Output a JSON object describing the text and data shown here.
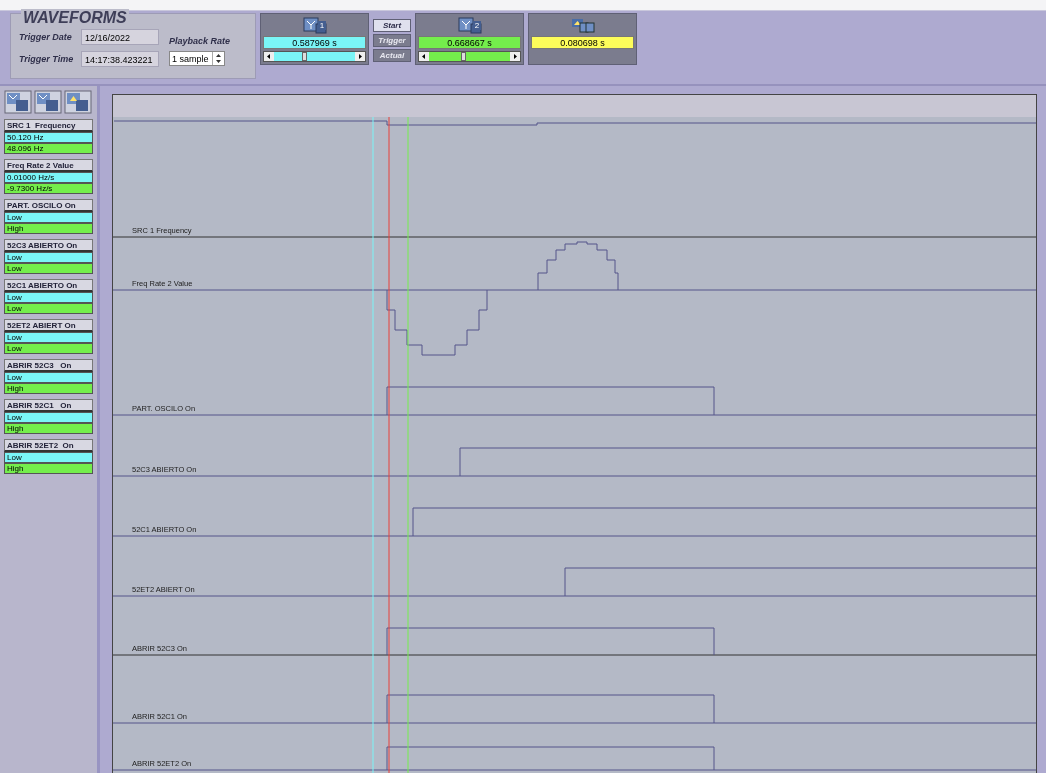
{
  "header": {
    "title": "WAVEFORMS",
    "trigger_date": {
      "label": "Trigger Date",
      "value": "12/16/2022"
    },
    "trigger_time": {
      "label": "Trigger Time",
      "value": "14:17:38.423221"
    },
    "playback_rate": {
      "label": "Playback Rate",
      "value": "1 sample"
    }
  },
  "cursors": [
    {
      "kind": "cursor1",
      "number": "1",
      "value": "0.587969 s",
      "color": "#7af5f7"
    },
    {
      "kind": "cursor2",
      "number": "2",
      "value": "0.668667 s",
      "color": "#74ee4c"
    },
    {
      "kind": "delta",
      "value": "0.080698 s",
      "color": "#fdfd5a"
    }
  ],
  "mode_buttons": [
    {
      "label": "Start",
      "selected": true
    },
    {
      "label": "Trigger",
      "selected": false
    },
    {
      "label": "Actual",
      "selected": false
    }
  ],
  "channels": [
    {
      "name": "SRC 1  Frequency",
      "cursor1": "50.120 Hz",
      "cursor2": "48.096 Hz"
    },
    {
      "name": "Freq Rate 2 Value",
      "cursor1": "0.01000 Hz/s",
      "cursor2": "-9.7300 Hz/s"
    },
    {
      "name": "PART. OSCILO On",
      "cursor1": "Low",
      "cursor2": "High"
    },
    {
      "name": "52C3 ABIERTO On",
      "cursor1": "Low",
      "cursor2": "Low"
    },
    {
      "name": "52C1 ABIERTO On",
      "cursor1": "Low",
      "cursor2": "Low"
    },
    {
      "name": "52ET2 ABIERT On",
      "cursor1": "Low",
      "cursor2": "Low"
    },
    {
      "name": "ABRIR 52C3   On",
      "cursor1": "Low",
      "cursor2": "High"
    },
    {
      "name": "ABRIR 52C1   On",
      "cursor1": "Low",
      "cursor2": "High"
    },
    {
      "name": "ABRIR 52ET2  On",
      "cursor1": "Low",
      "cursor2": "High"
    }
  ],
  "traces": [
    {
      "label": "SRC 1  Frequency"
    },
    {
      "label": "Freq Rate 2 Value"
    },
    {
      "label": "PART. OSCILO On"
    },
    {
      "label": "52C3 ABIERTO On"
    },
    {
      "label": "52C1 ABIERTO On"
    },
    {
      "label": "52ET2 ABIERT On"
    },
    {
      "label": "ABRIR 52C3   On"
    },
    {
      "label": "ABRIR 52C1   On"
    },
    {
      "label": "ABRIR 52ET2  On"
    }
  ]
}
